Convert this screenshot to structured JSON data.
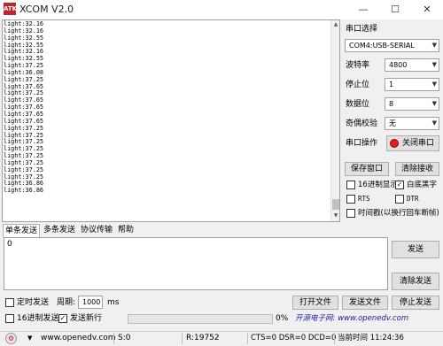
{
  "window": {
    "title": "XCOM V2.0",
    "icon_text": "ATK",
    "minimize": "—",
    "maximize": "☐",
    "close": "✕"
  },
  "receive": {
    "lines": [
      "light:32.16",
      "light:32.16",
      "light:32.55",
      "light:32.55",
      "light:32.16",
      "light:32.55",
      "light:37.25",
      "light:36.08",
      "light:37.25",
      "light:37.65",
      "light:37.25",
      "light:37.65",
      "light:37.65",
      "light:37.65",
      "light:37.65",
      "light:37.25",
      "light:37.25",
      "light:37.25",
      "light:37.25",
      "light:37.25",
      "light:37.25",
      "light:37.25",
      "light:37.25",
      "light:36.86",
      "light:36.86"
    ]
  },
  "settings": {
    "port_label": "串口选择",
    "port_value": "COM4:USB-SERIAL",
    "baud_label": "波特率",
    "baud_value": "4800",
    "stop_label": "停止位",
    "stop_value": "1",
    "data_label": "数据位",
    "data_value": "8",
    "parity_label": "奇偶校验",
    "parity_value": "无",
    "op_label": "串口操作",
    "op_button": "关闭串口",
    "save_button": "保存窗口",
    "clear_button": "清除接收",
    "hex_display": "16进制显示",
    "white_black": "白底黑字",
    "rts": "RTS",
    "dtr": "DTR",
    "timestamp": "时间戳(以换行回车断帧)"
  },
  "tabs": [
    "单条发送",
    "多条发送",
    "协议传输",
    "帮助"
  ],
  "send": {
    "text": "0",
    "send_button": "发送",
    "clear_send_button": "清除发送",
    "timed_send": "定时发送",
    "period_label": "周期:",
    "period_value": "1000",
    "period_unit": "ms",
    "hex_send": "16进制发送",
    "newline": "发送新行",
    "open_file": "打开文件",
    "send_file": "发送文件",
    "stop_send": "停止发送",
    "progress_text": "0%",
    "site_text": "开源电子网: www.openedv.com"
  },
  "status": {
    "url": "www.openedv.com",
    "s": "S:0",
    "r": "R:19752",
    "lines": "CTS=0 DSR=0 DCD=0",
    "time": "当前时间 11:24:36"
  }
}
